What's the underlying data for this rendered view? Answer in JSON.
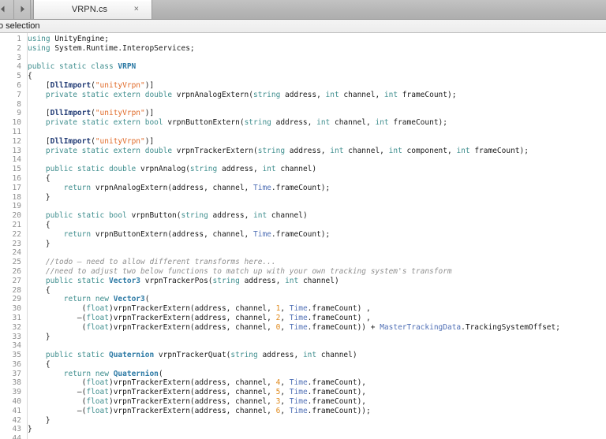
{
  "window": {
    "tabbar": {
      "back_arrow": "back-arrow",
      "forward_arrow": "forward-arrow",
      "tab_title": "VRPN.cs",
      "tab_close": "×"
    },
    "pathbar": {
      "text": "No selection"
    }
  },
  "colors": {
    "keyword": "#3f8e8e",
    "type": "#2d7aa5",
    "class_ref": "#4f6fb5",
    "attribute": "#203a74",
    "string": "#e06a28",
    "number": "#e08a1e",
    "comment": "#8f8f8f",
    "plain": "#1a1a1a",
    "gutter_text": "#8d8d8d",
    "editor_bg": "#ffffff",
    "tabbar_bg": "#b9b9b9"
  },
  "editor": {
    "language": "csharp",
    "first_line": 1,
    "last_line": 44,
    "lines": [
      {
        "n": 1,
        "tokens": [
          [
            "kw",
            "using"
          ],
          [
            "pln",
            " UnityEngine;"
          ]
        ]
      },
      {
        "n": 2,
        "tokens": [
          [
            "kw",
            "using"
          ],
          [
            "pln",
            " System.Runtime.InteropServices;"
          ]
        ]
      },
      {
        "n": 3,
        "tokens": []
      },
      {
        "n": 4,
        "tokens": [
          [
            "kw",
            "public static class "
          ],
          [
            "typ",
            "VRPN"
          ]
        ]
      },
      {
        "n": 5,
        "tokens": [
          [
            "pln",
            "{"
          ]
        ]
      },
      {
        "n": 6,
        "tokens": [
          [
            "pln",
            "    ["
          ],
          [
            "attr",
            "DllImport"
          ],
          [
            "pln",
            "("
          ],
          [
            "str",
            "\"unityVrpn\""
          ],
          [
            "pln",
            ")]"
          ]
        ]
      },
      {
        "n": 7,
        "tokens": [
          [
            "pln",
            "    "
          ],
          [
            "kw",
            "private static extern double"
          ],
          [
            "pln",
            " vrpnAnalogExtern("
          ],
          [
            "kw",
            "string"
          ],
          [
            "pln",
            " address, "
          ],
          [
            "kw",
            "int"
          ],
          [
            "pln",
            " channel, "
          ],
          [
            "kw",
            "int"
          ],
          [
            "pln",
            " frameCount);"
          ]
        ]
      },
      {
        "n": 8,
        "tokens": []
      },
      {
        "n": 9,
        "tokens": [
          [
            "pln",
            "    ["
          ],
          [
            "attr",
            "DllImport"
          ],
          [
            "pln",
            "("
          ],
          [
            "str",
            "\"unityVrpn\""
          ],
          [
            "pln",
            ")]"
          ]
        ]
      },
      {
        "n": 10,
        "tokens": [
          [
            "pln",
            "    "
          ],
          [
            "kw",
            "private static extern bool"
          ],
          [
            "pln",
            " vrpnButtonExtern("
          ],
          [
            "kw",
            "string"
          ],
          [
            "pln",
            " address, "
          ],
          [
            "kw",
            "int"
          ],
          [
            "pln",
            " channel, "
          ],
          [
            "kw",
            "int"
          ],
          [
            "pln",
            " frameCount);"
          ]
        ]
      },
      {
        "n": 11,
        "tokens": []
      },
      {
        "n": 12,
        "tokens": [
          [
            "pln",
            "    ["
          ],
          [
            "attr",
            "DllImport"
          ],
          [
            "pln",
            "("
          ],
          [
            "str",
            "\"unityVrpn\""
          ],
          [
            "pln",
            ")]"
          ]
        ]
      },
      {
        "n": 13,
        "tokens": [
          [
            "pln",
            "    "
          ],
          [
            "kw",
            "private static extern double"
          ],
          [
            "pln",
            " vrpnTrackerExtern("
          ],
          [
            "kw",
            "string"
          ],
          [
            "pln",
            " address, "
          ],
          [
            "kw",
            "int"
          ],
          [
            "pln",
            " channel, "
          ],
          [
            "kw",
            "int"
          ],
          [
            "pln",
            " component, "
          ],
          [
            "kw",
            "int"
          ],
          [
            "pln",
            " frameCount);"
          ]
        ]
      },
      {
        "n": 14,
        "tokens": []
      },
      {
        "n": 15,
        "tokens": [
          [
            "pln",
            "    "
          ],
          [
            "kw",
            "public static double"
          ],
          [
            "pln",
            " vrpnAnalog("
          ],
          [
            "kw",
            "string"
          ],
          [
            "pln",
            " address, "
          ],
          [
            "kw",
            "int"
          ],
          [
            "pln",
            " channel)"
          ]
        ]
      },
      {
        "n": 16,
        "tokens": [
          [
            "pln",
            "    {"
          ]
        ]
      },
      {
        "n": 17,
        "tokens": [
          [
            "pln",
            "        "
          ],
          [
            "kw",
            "return"
          ],
          [
            "pln",
            " vrpnAnalogExtern(address, channel, "
          ],
          [
            "cls",
            "Time"
          ],
          [
            "pln",
            ".frameCount);"
          ]
        ]
      },
      {
        "n": 18,
        "tokens": [
          [
            "pln",
            "    }"
          ]
        ]
      },
      {
        "n": 19,
        "tokens": []
      },
      {
        "n": 20,
        "tokens": [
          [
            "pln",
            "    "
          ],
          [
            "kw",
            "public static bool"
          ],
          [
            "pln",
            " vrpnButton("
          ],
          [
            "kw",
            "string"
          ],
          [
            "pln",
            " address, "
          ],
          [
            "kw",
            "int"
          ],
          [
            "pln",
            " channel)"
          ]
        ]
      },
      {
        "n": 21,
        "tokens": [
          [
            "pln",
            "    {"
          ]
        ]
      },
      {
        "n": 22,
        "tokens": [
          [
            "pln",
            "        "
          ],
          [
            "kw",
            "return"
          ],
          [
            "pln",
            " vrpnButtonExtern(address, channel, "
          ],
          [
            "cls",
            "Time"
          ],
          [
            "pln",
            ".frameCount);"
          ]
        ]
      },
      {
        "n": 23,
        "tokens": [
          [
            "pln",
            "    }"
          ]
        ]
      },
      {
        "n": 24,
        "tokens": []
      },
      {
        "n": 25,
        "tokens": [
          [
            "pln",
            "    "
          ],
          [
            "cmt",
            "//todo – need to allow different transforms here..."
          ]
        ]
      },
      {
        "n": 26,
        "tokens": [
          [
            "pln",
            "    "
          ],
          [
            "cmt",
            "//need to adjust two below functions to match up with your own tracking system's transform"
          ]
        ]
      },
      {
        "n": 27,
        "tokens": [
          [
            "pln",
            "    "
          ],
          [
            "kw",
            "public static "
          ],
          [
            "typ",
            "Vector3"
          ],
          [
            "pln",
            " vrpnTrackerPos("
          ],
          [
            "kw",
            "string"
          ],
          [
            "pln",
            " address, "
          ],
          [
            "kw",
            "int"
          ],
          [
            "pln",
            " channel)"
          ]
        ]
      },
      {
        "n": 28,
        "tokens": [
          [
            "pln",
            "    {"
          ]
        ]
      },
      {
        "n": 29,
        "tokens": [
          [
            "pln",
            "        "
          ],
          [
            "kw",
            "return new "
          ],
          [
            "typ",
            "Vector3"
          ],
          [
            "pln",
            "("
          ]
        ]
      },
      {
        "n": 30,
        "tokens": [
          [
            "pln",
            "            ("
          ],
          [
            "kw",
            "float"
          ],
          [
            "pln",
            ")vrpnTrackerExtern(address, channel, "
          ],
          [
            "num",
            "1"
          ],
          [
            "pln",
            ", "
          ],
          [
            "cls",
            "Time"
          ],
          [
            "pln",
            ".frameCount) ,"
          ]
        ]
      },
      {
        "n": 31,
        "tokens": [
          [
            "pln",
            "           –("
          ],
          [
            "kw",
            "float"
          ],
          [
            "pln",
            ")vrpnTrackerExtern(address, channel, "
          ],
          [
            "num",
            "2"
          ],
          [
            "pln",
            ", "
          ],
          [
            "cls",
            "Time"
          ],
          [
            "pln",
            ".frameCount) ,"
          ]
        ]
      },
      {
        "n": 32,
        "tokens": [
          [
            "pln",
            "            ("
          ],
          [
            "kw",
            "float"
          ],
          [
            "pln",
            ")vrpnTrackerExtern(address, channel, "
          ],
          [
            "num",
            "0"
          ],
          [
            "pln",
            ", "
          ],
          [
            "cls",
            "Time"
          ],
          [
            "pln",
            ".frameCount)) + "
          ],
          [
            "cls",
            "MasterTrackingData"
          ],
          [
            "pln",
            ".TrackingSystemOffset;"
          ]
        ]
      },
      {
        "n": 33,
        "tokens": [
          [
            "pln",
            "    }"
          ]
        ]
      },
      {
        "n": 34,
        "tokens": []
      },
      {
        "n": 35,
        "tokens": [
          [
            "pln",
            "    "
          ],
          [
            "kw",
            "public static "
          ],
          [
            "typ",
            "Quaternion"
          ],
          [
            "pln",
            " vrpnTrackerQuat("
          ],
          [
            "kw",
            "string"
          ],
          [
            "pln",
            " address, "
          ],
          [
            "kw",
            "int"
          ],
          [
            "pln",
            " channel)"
          ]
        ]
      },
      {
        "n": 36,
        "tokens": [
          [
            "pln",
            "    {"
          ]
        ]
      },
      {
        "n": 37,
        "tokens": [
          [
            "pln",
            "        "
          ],
          [
            "kw",
            "return new "
          ],
          [
            "typ",
            "Quaternion"
          ],
          [
            "pln",
            "("
          ]
        ]
      },
      {
        "n": 38,
        "tokens": [
          [
            "pln",
            "            ("
          ],
          [
            "kw",
            "float"
          ],
          [
            "pln",
            ")vrpnTrackerExtern(address, channel, "
          ],
          [
            "num",
            "4"
          ],
          [
            "pln",
            ", "
          ],
          [
            "cls",
            "Time"
          ],
          [
            "pln",
            ".frameCount),"
          ]
        ]
      },
      {
        "n": 39,
        "tokens": [
          [
            "pln",
            "           –("
          ],
          [
            "kw",
            "float"
          ],
          [
            "pln",
            ")vrpnTrackerExtern(address, channel, "
          ],
          [
            "num",
            "5"
          ],
          [
            "pln",
            ", "
          ],
          [
            "cls",
            "Time"
          ],
          [
            "pln",
            ".frameCount),"
          ]
        ]
      },
      {
        "n": 40,
        "tokens": [
          [
            "pln",
            "            ("
          ],
          [
            "kw",
            "float"
          ],
          [
            "pln",
            ")vrpnTrackerExtern(address, channel, "
          ],
          [
            "num",
            "3"
          ],
          [
            "pln",
            ", "
          ],
          [
            "cls",
            "Time"
          ],
          [
            "pln",
            ".frameCount),"
          ]
        ]
      },
      {
        "n": 41,
        "tokens": [
          [
            "pln",
            "           –("
          ],
          [
            "kw",
            "float"
          ],
          [
            "pln",
            ")vrpnTrackerExtern(address, channel, "
          ],
          [
            "num",
            "6"
          ],
          [
            "pln",
            ", "
          ],
          [
            "cls",
            "Time"
          ],
          [
            "pln",
            ".frameCount));"
          ]
        ]
      },
      {
        "n": 42,
        "tokens": [
          [
            "pln",
            "    }"
          ]
        ]
      },
      {
        "n": 43,
        "tokens": [
          [
            "pln",
            "}"
          ]
        ]
      },
      {
        "n": 44,
        "tokens": []
      }
    ]
  }
}
